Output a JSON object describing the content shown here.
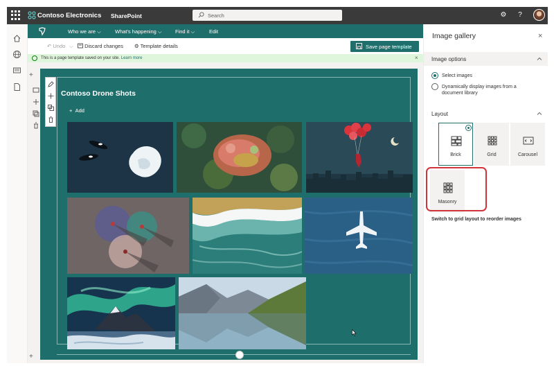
{
  "suite": {
    "brand": "Contoso Electronics",
    "app": "SharePoint",
    "search_placeholder": "Search"
  },
  "site_nav": {
    "items": [
      {
        "label": "Who we are"
      },
      {
        "label": "What's happening"
      },
      {
        "label": "Find it"
      },
      {
        "label": "Edit"
      }
    ]
  },
  "command_bar": {
    "undo": "Undo",
    "discard": "Discard changes",
    "details": "Template details",
    "save": "Save page template"
  },
  "message_bar": {
    "text": "This is a page template saved on your site.",
    "link": "Learn more"
  },
  "web_part": {
    "title": "Contoso Drone Shots",
    "add_label": "Add",
    "images": [
      {
        "name": "whales-iceberg",
        "subject": "orcas-and-ice"
      },
      {
        "name": "autumn-forest",
        "subject": "forest-canopy"
      },
      {
        "name": "balloon-night",
        "subject": "balloons-moon"
      },
      {
        "name": "three-circles",
        "subject": "people-circles"
      },
      {
        "name": "waves-shore",
        "subject": "beach-waves"
      },
      {
        "name": "airplane-ocean",
        "subject": "plane-over-sea"
      },
      {
        "name": "aurora-mountain",
        "subject": "northern-lights"
      },
      {
        "name": "mountain-lake",
        "subject": "fjord-reflection"
      }
    ]
  },
  "panel": {
    "title": "Image gallery",
    "image_options_header": "Image options",
    "radio_select": "Select images",
    "radio_dynamic": "Dynamically display images from a document library",
    "layout_header": "Layout",
    "layouts": [
      {
        "label": "Brick",
        "selected": true
      },
      {
        "label": "Grid",
        "selected": false
      },
      {
        "label": "Carousel",
        "selected": false
      },
      {
        "label": "Masonry",
        "selected": false
      }
    ],
    "note": "Switch to grid layout to reorder images"
  },
  "colors": {
    "accent": "#1e6f6c",
    "suite_bar": "#3a3a3a",
    "highlight": "#d13438"
  }
}
